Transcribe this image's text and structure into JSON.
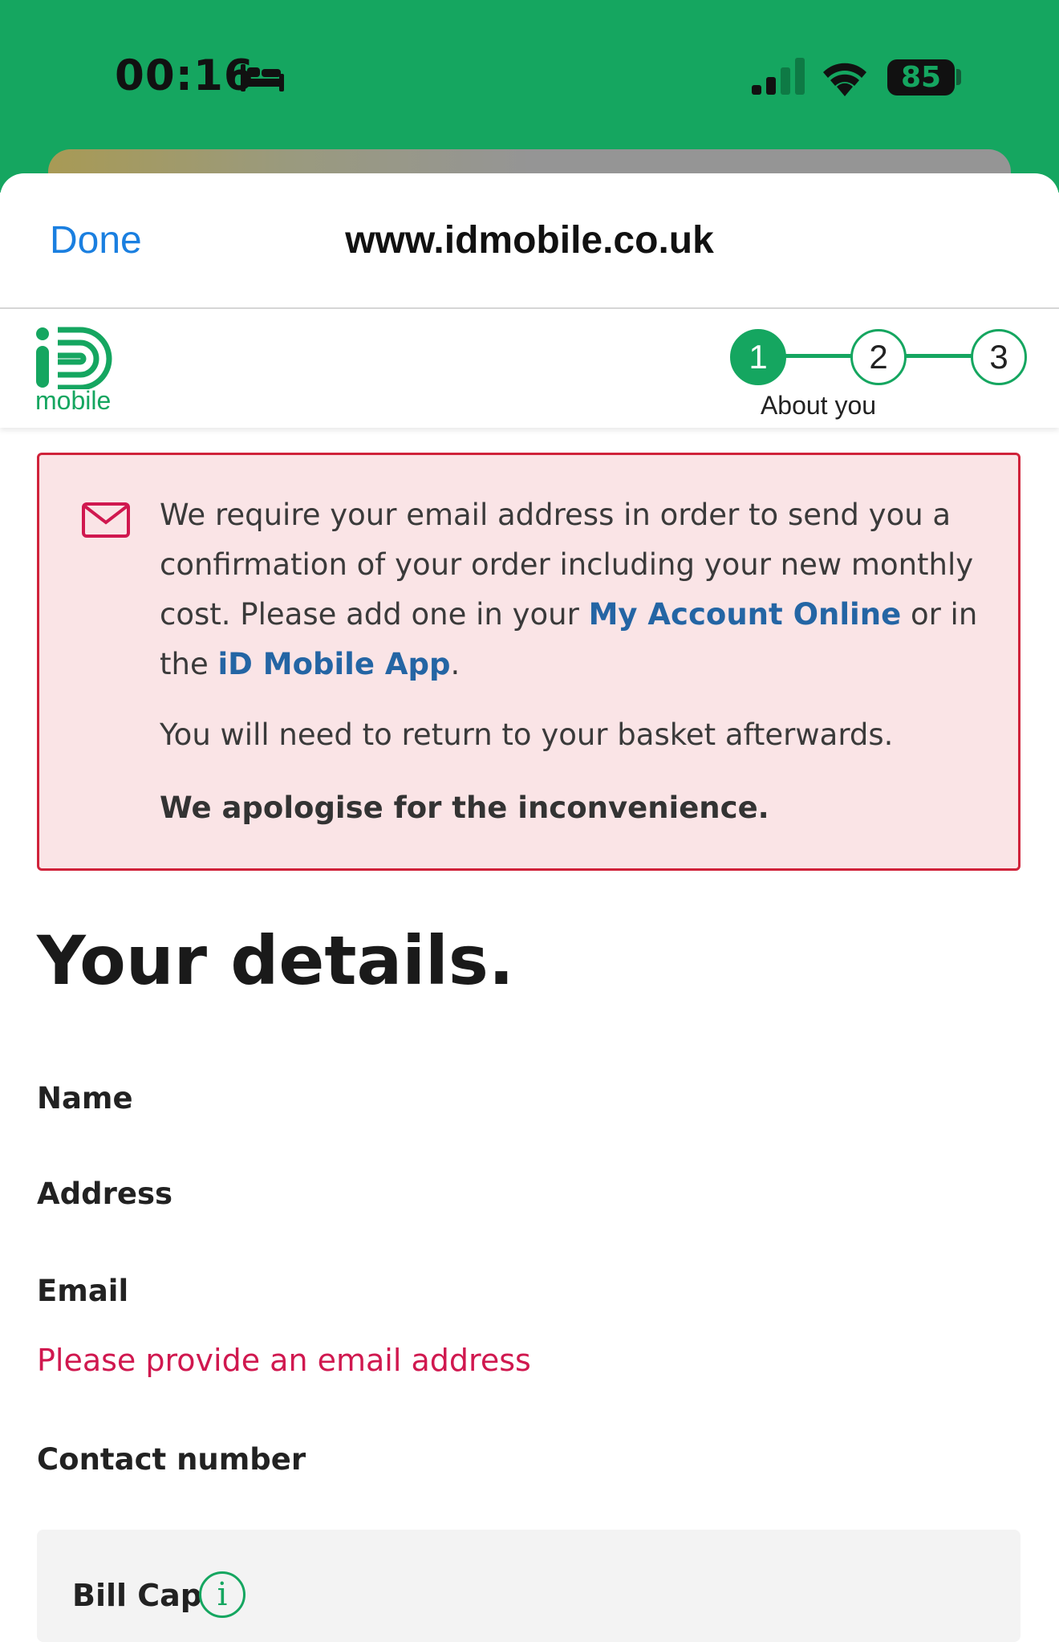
{
  "status_bar": {
    "time": "00:16",
    "focus_icon": "bed-icon",
    "signal_icon": "cellular-signal-icon",
    "signal_bars_active": 2,
    "signal_bars_total": 4,
    "wifi_icon": "wifi-icon",
    "battery": "85"
  },
  "browser": {
    "done_label": "Done",
    "url": "www.idmobile.co.uk"
  },
  "site": {
    "logo_text": "mobile",
    "steps": [
      "1",
      "2",
      "3"
    ],
    "active_step_index": 0,
    "active_step_label": "About you"
  },
  "alert": {
    "icon": "mail-icon",
    "text_before_link1": "We require your email address in order to send you a confirmation of your order including your new monthly cost. Please add one in your ",
    "link1": "My Account Online",
    "text_between": " or in the ",
    "link2": "iD Mobile App",
    "text_after": ".",
    "note": "You will need to return to your basket afterwards.",
    "apology": "We apologise for the inconvenience."
  },
  "details": {
    "title": "Your details.",
    "name_label": "Name",
    "address_label": "Address",
    "email_label": "Email",
    "email_error": "Please provide an email address",
    "contact_label": "Contact number"
  },
  "bill_cap": {
    "label": "Bill Cap",
    "info_icon_glyph": "i"
  },
  "colors": {
    "brand_green": "#15a660",
    "link_blue": "#2465a4",
    "ios_blue": "#1a7fe0",
    "error_red": "#d0184f",
    "alert_border": "#d0223a",
    "alert_bg": "#fae4e6"
  }
}
